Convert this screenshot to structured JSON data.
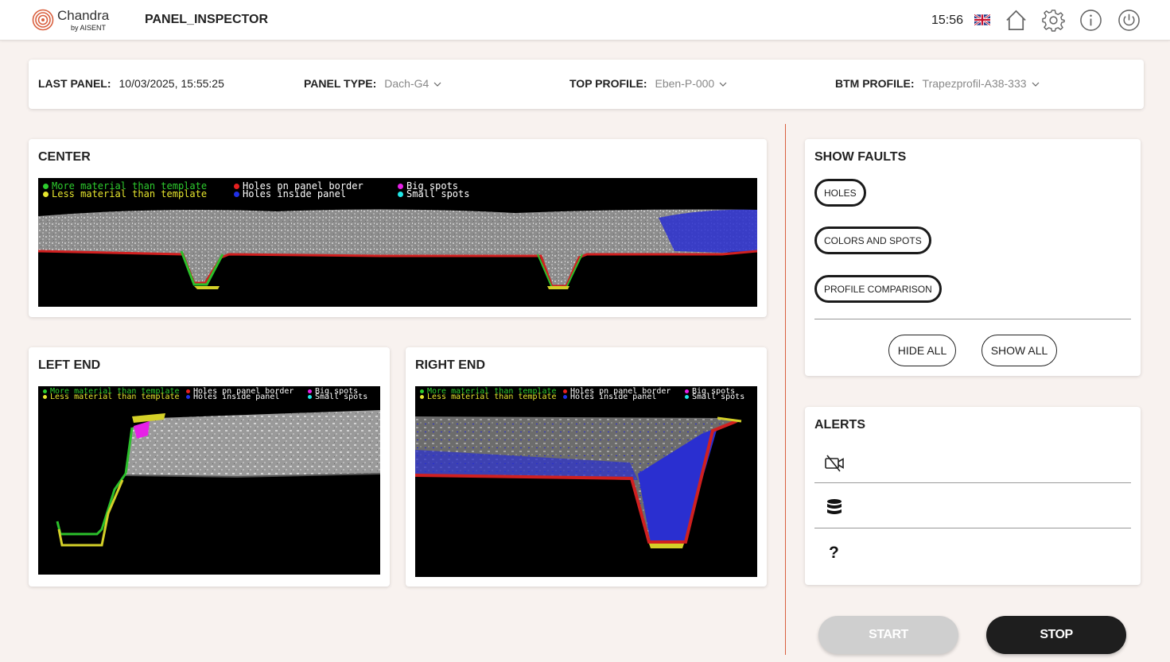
{
  "header": {
    "brand_name": "Chandra",
    "brand_sub": "by AISENT",
    "app_title": "PANEL_INSPECTOR",
    "time": "15:56",
    "language_icon": "uk-flag-icon",
    "icons": [
      "home-icon",
      "gear-icon",
      "info-icon",
      "power-icon"
    ]
  },
  "info": {
    "last_panel_label": "LAST PANEL:",
    "last_panel_value": "10/03/2025, 15:55:25",
    "panel_type_label": "PANEL TYPE:",
    "panel_type_value": "Dach-G4",
    "top_profile_label": "TOP PROFILE:",
    "top_profile_value": "Eben-P-000",
    "btm_profile_label": "BTM PROFILE:",
    "btm_profile_value": "Trapezprofil-A38-333"
  },
  "cameras": {
    "center_title": "CENTER",
    "left_title": "LEFT END",
    "right_title": "RIGHT END"
  },
  "legend": {
    "more_material": "More material than template",
    "less_material": "Less material than template",
    "holes_border": "Holes pn panel border",
    "holes_inside": "Holes inside panel",
    "big_spots": "Big spots",
    "small_spots": "Small spots",
    "colors": {
      "more": "#2ecc2e",
      "less": "#e6e62e",
      "holes_border": "#e62020",
      "holes_inside": "#2030e6",
      "big_spots": "#e620e6",
      "small_spots": "#20e6e6"
    }
  },
  "faults": {
    "title": "SHOW FAULTS",
    "holes": "HOLES",
    "colors_spots": "COLORS AND SPOTS",
    "profile_comparison": "PROFILE COMPARISON",
    "hide_all": "HIDE ALL",
    "show_all": "SHOW ALL"
  },
  "alerts": {
    "title": "ALERTS",
    "items": [
      "camera-off-icon",
      "database-icon",
      "question-icon"
    ],
    "unknown_symbol": "?"
  },
  "controls": {
    "start": "START",
    "stop": "STOP"
  },
  "theme": {
    "accent": "#d9603f",
    "background": "#f8f2ef",
    "stop_bg": "#1e1e1e",
    "start_bg": "#cfcfcf"
  }
}
